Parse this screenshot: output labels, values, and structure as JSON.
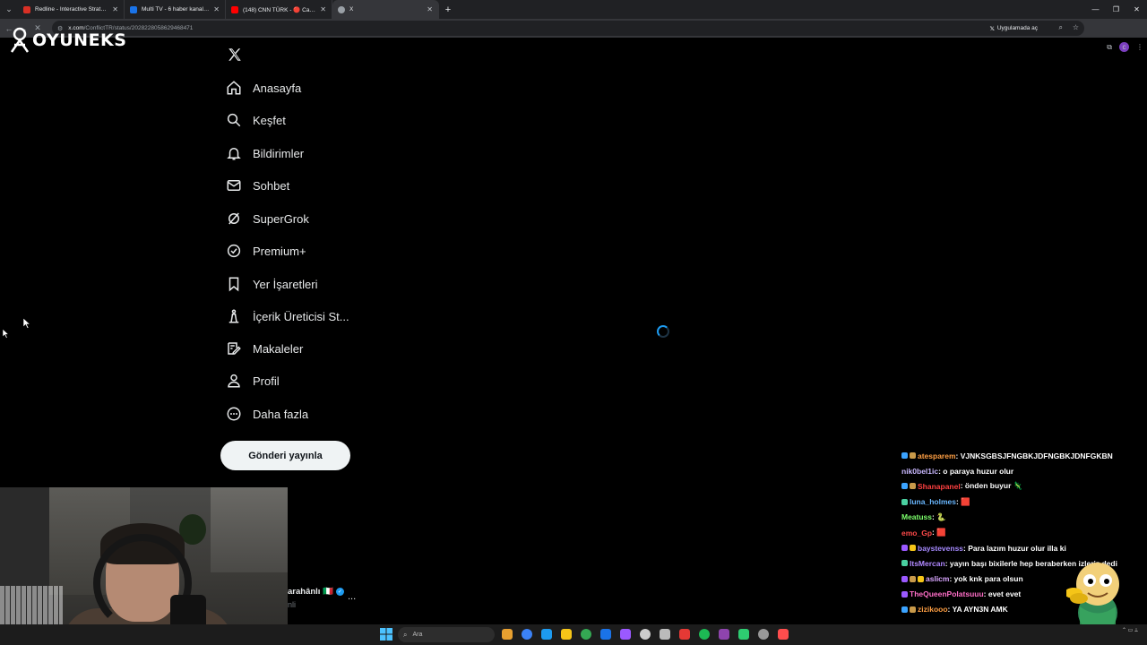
{
  "browser": {
    "tabs": [
      {
        "title": "Redline - Interactive Strategic N...",
        "active": false,
        "color": "#d93025"
      },
      {
        "title": "Multi TV - 6 haber kanalını aynı...",
        "active": false,
        "color": "#1a73e8"
      },
      {
        "title": "(148) CNN TÜRK - 🔴 Canlı Ya...",
        "active": false,
        "color": "#ff0000"
      },
      {
        "title": "X",
        "active": true,
        "color": "#9aa0a6"
      }
    ],
    "url_domain": "x.com",
    "url_path": "/ConflictTR/status/2028228058629468471",
    "open_app_label": "Uygulamada aç"
  },
  "overlay": {
    "logo_text": "OYUNEKS"
  },
  "sidebar": {
    "items": [
      {
        "label": "Anasayfa",
        "icon": "home-icon"
      },
      {
        "label": "Keşfet",
        "icon": "search-icon"
      },
      {
        "label": "Bildirimler",
        "icon": "bell-icon"
      },
      {
        "label": "Sohbet",
        "icon": "mail-icon"
      },
      {
        "label": "SuperGrok",
        "icon": "grok-icon"
      },
      {
        "label": "Premium+",
        "icon": "verified-icon"
      },
      {
        "label": "Yer İşaretleri",
        "icon": "bookmark-icon"
      },
      {
        "label": "İçerik Üreticisi St...",
        "icon": "creator-studio-icon"
      },
      {
        "label": "Makaleler",
        "icon": "articles-icon"
      },
      {
        "label": "Profil",
        "icon": "profile-icon"
      },
      {
        "label": "Daha fazla",
        "icon": "more-circle-icon"
      }
    ],
    "post_button": "Gönderi yayınla"
  },
  "tweet_preview": {
    "author_partial": "arahânlı 🇮🇹",
    "handle_partial": "nli",
    "more": "..."
  },
  "chat": {
    "messages": [
      {
        "user": "atesparem",
        "text": " : VJNKSGBSJFNGBKJDFNGBKJDNFGKBN",
        "color": "#ff9f43",
        "badges": [
          "#3ba3ff",
          "#c99a4a"
        ]
      },
      {
        "user": "nik0bel1ic",
        "text": " : o paraya huzur olur",
        "color": "#c9b8ff",
        "badges": []
      },
      {
        "user": "Shanapanel",
        "text": " : önden buyur 🦎",
        "color": "#ff4040",
        "badges": [
          "#3ba3ff",
          "#c99a4a"
        ]
      },
      {
        "user": "luna_holmes",
        "text": " : 🟥",
        "color": "#69b7ff",
        "badges": [
          "#4ad0a0"
        ]
      },
      {
        "user": "Meatuss",
        "text": " : 🐍",
        "color": "#7cff6b",
        "badges": []
      },
      {
        "user": "emo_Gp",
        "text": " : 🟥",
        "color": "#ff4a4a",
        "badges": []
      },
      {
        "user": "baystevenss",
        "text": " : Para lazım huzur olur illa ki",
        "color": "#a68aff",
        "badges": [
          "#9b59ff",
          "#f5c518"
        ]
      },
      {
        "user": "ItsMercan",
        "text": " : yayın başı bixilerle hep beraberken izleriz dedi",
        "color": "#b088ff",
        "badges": [
          "#4ad0a0"
        ]
      },
      {
        "user": "aslicm",
        "text": " : yok knk para olsun",
        "color": "#d9a6ff",
        "badges": [
          "#9b59ff",
          "#c99a4a",
          "#f5c518"
        ]
      },
      {
        "user": "TheQueenPolatsuuu",
        "text": " : evet evet",
        "color": "#ff6ec7",
        "badges": [
          "#9b59ff"
        ]
      },
      {
        "user": "zizikooo",
        "text": " : YA AYN3N AMK",
        "color": "#ff9f43",
        "badges": [
          "#3ba3ff",
          "#c99a4a"
        ]
      }
    ]
  },
  "taskbar": {
    "search_placeholder": "Ara",
    "apps": [
      "#e8a030",
      "#3b82f6",
      "#1d9bf0",
      "#f5c518",
      "#34a853",
      "#1a73e8",
      "#9b59ff",
      "#cccccc",
      "#bbbbbb",
      "#e53935",
      "#1db954",
      "#8e44ad",
      "#2ecc71",
      "#999999",
      "#ff4d4d"
    ]
  }
}
